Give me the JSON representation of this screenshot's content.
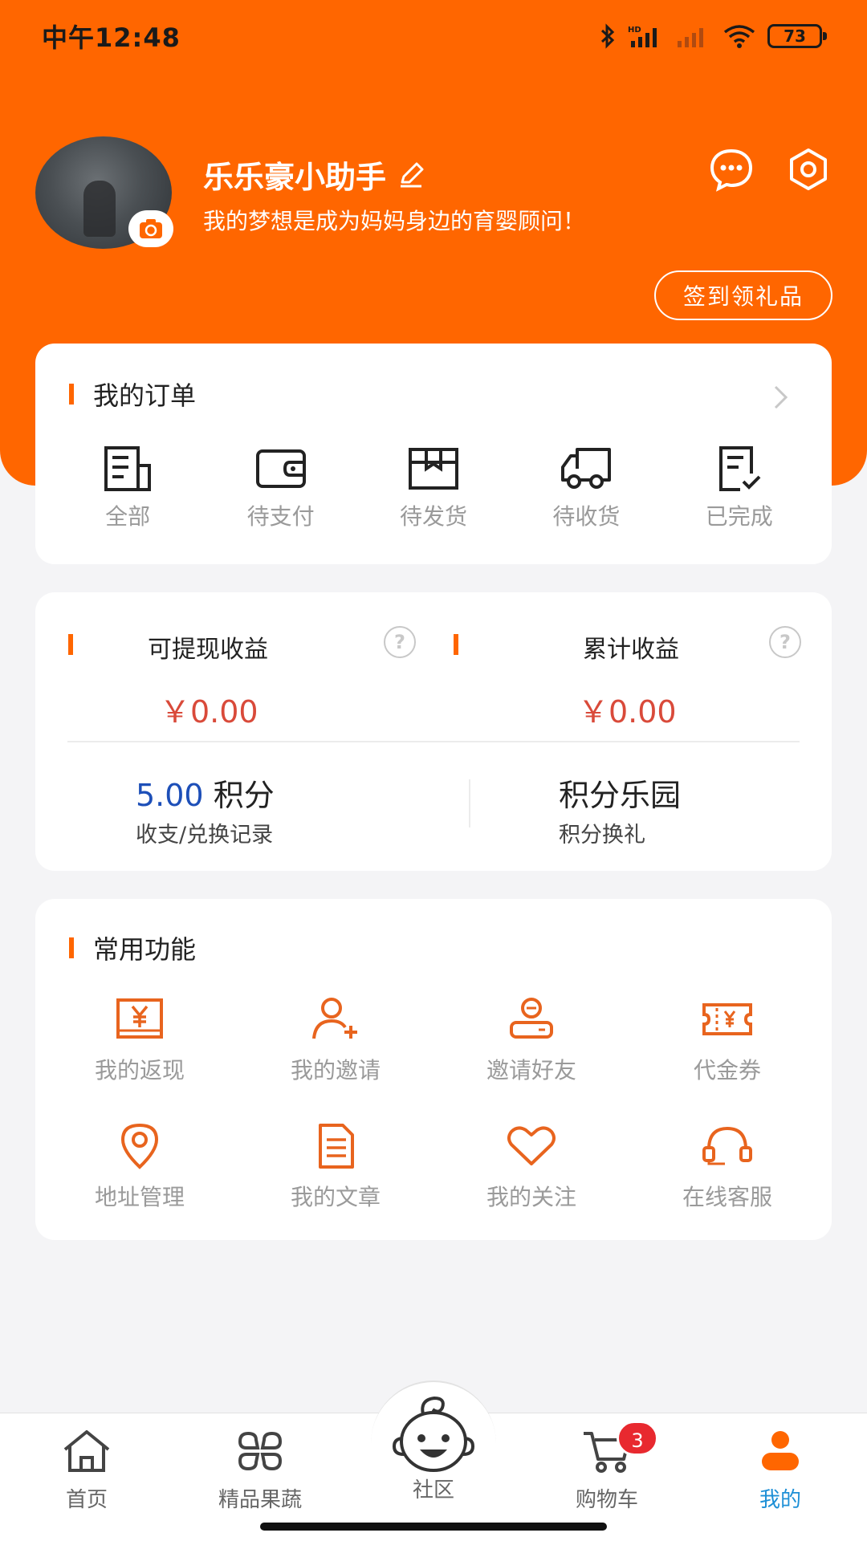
{
  "status_bar": {
    "time": "中午12:48",
    "battery": "73",
    "icons": [
      "bluetooth-icon",
      "hd-signal-icon",
      "signal-icon",
      "wifi-icon",
      "battery-icon"
    ]
  },
  "profile": {
    "name": "乐乐豪小助手",
    "bio": "我的梦想是成为妈妈身边的育婴顾问！",
    "checkin_label": "签到领礼品",
    "icons": [
      "message-icon",
      "settings-icon",
      "edit-icon",
      "camera-icon"
    ]
  },
  "orders": {
    "title": "我的订单",
    "items": [
      {
        "label": "全部",
        "icon": "order-all-icon"
      },
      {
        "label": "待支付",
        "icon": "wallet-icon"
      },
      {
        "label": "待发货",
        "icon": "package-icon"
      },
      {
        "label": "待收货",
        "icon": "truck-icon"
      },
      {
        "label": "已完成",
        "icon": "completed-icon"
      }
    ]
  },
  "earnings": {
    "withdrawable": {
      "title": "可提现收益",
      "amount": "￥0.00"
    },
    "total": {
      "title": "累计收益",
      "amount": "￥0.00"
    },
    "points": {
      "value": "5.00",
      "unit": "积分",
      "sub": "收支/兑换记录"
    },
    "park": {
      "title": "积分乐园",
      "sub": "积分换礼"
    }
  },
  "functions": {
    "title": "常用功能",
    "items": [
      {
        "label": "我的返现",
        "icon": "cashback-icon"
      },
      {
        "label": "我的邀请",
        "icon": "invite-user-icon"
      },
      {
        "label": "邀请好友",
        "icon": "invite-friend-icon"
      },
      {
        "label": "代金券",
        "icon": "coupon-icon"
      },
      {
        "label": "地址管理",
        "icon": "location-icon"
      },
      {
        "label": "我的文章",
        "icon": "article-icon"
      },
      {
        "label": "我的关注",
        "icon": "heart-icon"
      },
      {
        "label": "在线客服",
        "icon": "headset-icon"
      }
    ]
  },
  "tabbar": {
    "items": [
      {
        "label": "首页",
        "icon": "home-icon"
      },
      {
        "label": "精品果蔬",
        "icon": "grid-icon"
      },
      {
        "label": "社区",
        "icon": "baby-face-icon"
      },
      {
        "label": "购物车",
        "icon": "cart-icon",
        "badge": "3"
      },
      {
        "label": "我的",
        "icon": "user-icon",
        "active": true
      }
    ]
  },
  "colors": {
    "brand": "#ff6600",
    "amount": "#d94a3a",
    "points": "#1d4fb8",
    "active_tab": "#1d8fd6"
  }
}
